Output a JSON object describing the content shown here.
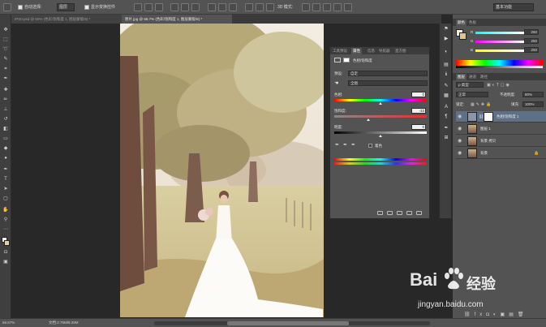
{
  "options_bar": {
    "auto_select_label": "自动选择:",
    "auto_select_target": "图层",
    "show_transform_label": "显示变换控件",
    "mode_3d_label": "3D 模式:",
    "workspace": "基本功能"
  },
  "tabs": [
    {
      "label": "IPS0.psd @ 50% (色彩/饱和度 1, 图层蒙版/8) *",
      "active": false
    },
    {
      "label": "原片.jpg @ 66.7% (色彩/饱和度 1, 图层蒙版/8) *",
      "active": true
    }
  ],
  "status": {
    "zoom": "66.67%",
    "doc_info": "文档:2.75M/8.29M"
  },
  "properties": {
    "tabs": [
      "工具预设",
      "属性",
      "信息",
      "导航器",
      "直方图"
    ],
    "active_tab": 1,
    "title": "色相/饱和度",
    "preset_label": "预设:",
    "preset_value": "自定",
    "channel_value": "全图",
    "hue_label": "色相:",
    "hue_value": "0",
    "saturation_label": "饱和度:",
    "saturation_value": "-33",
    "saturation_fraction": 0.37,
    "lightness_label": "明度:",
    "lightness_value": "0",
    "colorize_label": "着色"
  },
  "color_panel": {
    "tabs": [
      "颜色",
      "色板"
    ],
    "r_label": "R",
    "g_label": "G",
    "b_label": "B",
    "r_value": "250",
    "g_value": "250",
    "b_value": "250"
  },
  "layers_panel": {
    "tabs": [
      "图层",
      "通道",
      "路径"
    ],
    "filter_kind": "ρ 类型",
    "blend_mode": "正常",
    "opacity_label": "不透明度:",
    "opacity_value": "80%",
    "lock_label": "锁定:",
    "fill_label": "填充:",
    "fill_value": "100%",
    "layers": [
      {
        "name": "色相/饱和度 1",
        "selected": true,
        "type": "adjustment"
      },
      {
        "name": "图层 1",
        "selected": false,
        "type": "photo"
      },
      {
        "name": "背景 拷贝",
        "selected": false,
        "type": "photo"
      },
      {
        "name": "背景",
        "selected": false,
        "type": "photo"
      }
    ]
  },
  "watermark": {
    "brand_left": "Bai",
    "brand_right": "经验",
    "url": "jingyan.baidu.com"
  },
  "colors": {
    "panel": "#535353",
    "dark": "#282828",
    "selection": "#5e7088"
  }
}
